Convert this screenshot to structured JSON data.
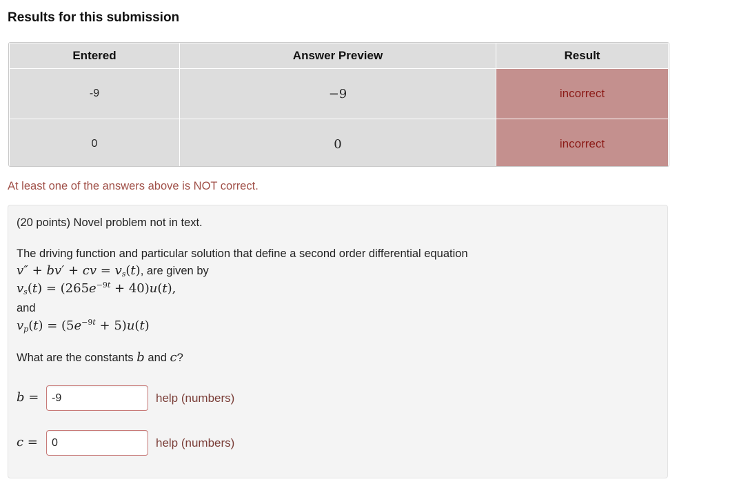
{
  "heading": "Results for this submission",
  "results_table": {
    "headers": [
      "Entered",
      "Answer Preview",
      "Result"
    ],
    "rows": [
      {
        "entered": "-9",
        "preview": "−9",
        "result": "incorrect"
      },
      {
        "entered": "0",
        "preview": "0",
        "result": "incorrect"
      }
    ]
  },
  "colors": {
    "incorrect_bg": "#c4908e",
    "incorrect_text": "#8b1a16",
    "warning_text": "#a05048"
  },
  "warning": "At least one of the answers above is NOT correct.",
  "problem": {
    "points_line": "(20 points) Novel problem not in text.",
    "intro": "The driving function and particular solution that define a second order differential equation",
    "equation_tail": ", are given by",
    "and": "and",
    "question_pre": "What are the constants",
    "question_and": "and",
    "question_end": "?"
  },
  "answers": [
    {
      "label": "b =",
      "value": "-9",
      "help": "help (numbers)"
    },
    {
      "label": "c =",
      "value": "0",
      "help": "help (numbers)"
    }
  ]
}
